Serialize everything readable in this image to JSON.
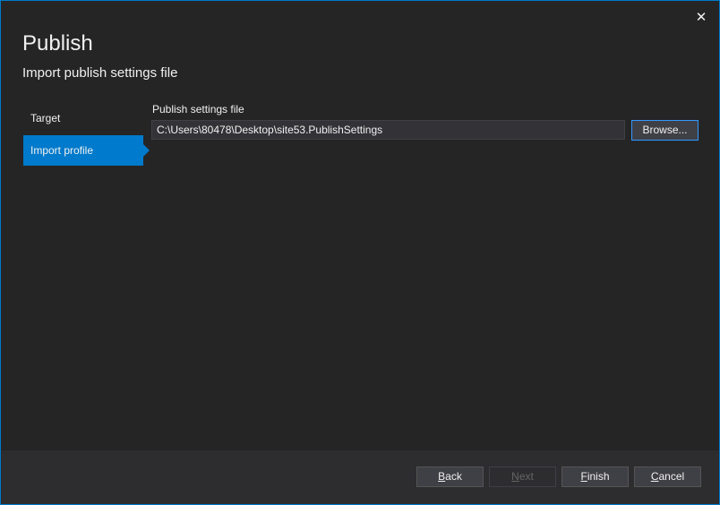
{
  "window": {
    "title": "Publish",
    "subtitle": "Import publish settings file",
    "close_icon": "close-icon",
    "accent_color": "#007acc"
  },
  "nav": {
    "items": [
      {
        "label": "Target",
        "active": false
      },
      {
        "label": "Import profile",
        "active": true
      }
    ]
  },
  "form": {
    "field_label": "Publish settings file",
    "file_path": "C:\\Users\\80478\\Desktop\\site53.PublishSettings",
    "browse_label": "Browse..."
  },
  "footer": {
    "back_first": "B",
    "back_rest": "ack",
    "next_first": "N",
    "next_rest": "ext",
    "next_disabled": true,
    "finish_first": "F",
    "finish_rest": "inish",
    "cancel_first": "C",
    "cancel_rest": "ancel"
  }
}
